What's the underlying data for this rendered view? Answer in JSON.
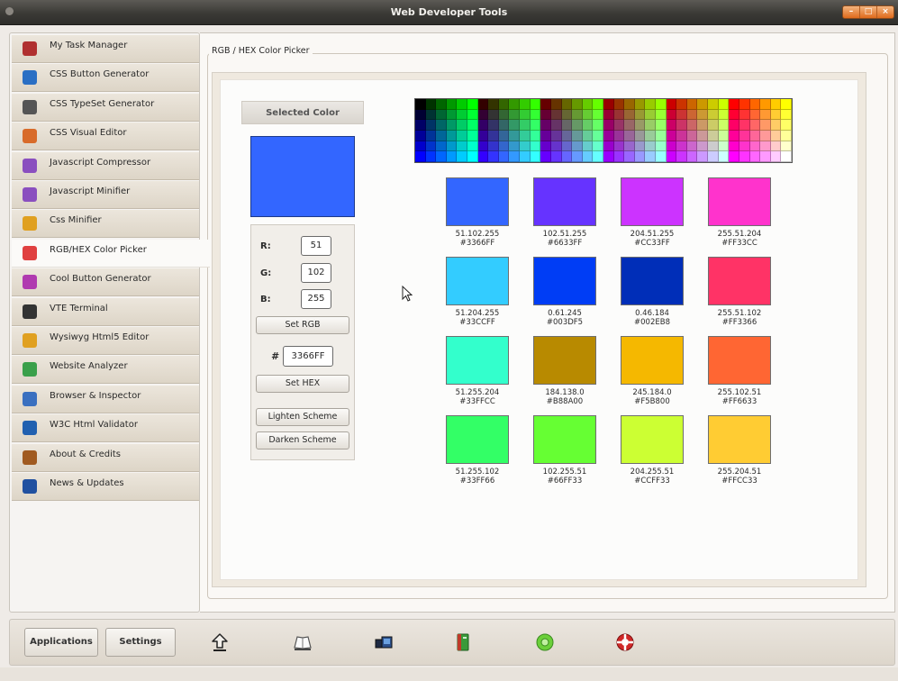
{
  "window": {
    "title": "Web Developer Tools",
    "controls": [
      "–",
      "□",
      "×"
    ]
  },
  "sidebar": {
    "items": [
      {
        "label": "My Task Manager",
        "icon": "clipboard-icon",
        "color": "#b03030"
      },
      {
        "label": "CSS Button Generator",
        "icon": "blocks-icon",
        "color": "#2a6fc4"
      },
      {
        "label": "CSS TypeSet Generator",
        "icon": "typeset-circle-icon",
        "color": "#555555"
      },
      {
        "label": "CSS Visual Editor",
        "icon": "palette-brush-icon",
        "color": "#d86b2a"
      },
      {
        "label": "Javascript Compressor",
        "icon": "js-file-icon",
        "color": "#8a4fbf"
      },
      {
        "label": "Javascript Minifier",
        "icon": "js-file-icon",
        "color": "#8a4fbf"
      },
      {
        "label": "Css Minifier",
        "icon": "css-badge-icon",
        "color": "#e0a020"
      },
      {
        "label": "RGB/HEX Color Picker",
        "icon": "color-wheel-icon",
        "color": "#e04040"
      },
      {
        "label": "Cool Button Generator",
        "icon": "button-magic-icon",
        "color": "#b03ab0"
      },
      {
        "label": "VTE Terminal",
        "icon": "terminal-icon",
        "color": "#333333"
      },
      {
        "label": "Wysiwyg Html5 Editor",
        "icon": "pencil-doc-icon",
        "color": "#e0a020"
      },
      {
        "label": "Website Analyzer",
        "icon": "gear-globe-icon",
        "color": "#3aa04a"
      },
      {
        "label": "Browser & Inspector",
        "icon": "browser-globe-icon",
        "color": "#3a70c0"
      },
      {
        "label": "W3C Html Validator",
        "icon": "w3c-icon",
        "color": "#2060b0"
      },
      {
        "label": "About & Credits",
        "icon": "person-icon",
        "color": "#a05a20"
      },
      {
        "label": "News & Updates",
        "icon": "rss-icon",
        "color": "#2050a0"
      }
    ],
    "active_index": 7
  },
  "main": {
    "group_title": "RGB / HEX Color Picker",
    "selected": {
      "header": "Selected Color",
      "color": "#3366FF",
      "r_label": "R:",
      "g_label": "G:",
      "b_label": "B:",
      "r": "51",
      "g": "102",
      "b": "255",
      "set_rgb": "Set RGB",
      "hash": "#",
      "hex": "3366FF",
      "set_hex": "Set HEX",
      "lighten": "Lighten Scheme",
      "darken": "Darken Scheme"
    },
    "swatches": [
      {
        "rgb": "51.102.255",
        "hex": "#3366FF",
        "color": "#3366FF"
      },
      {
        "rgb": "102.51.255",
        "hex": "#6633FF",
        "color": "#6633FF"
      },
      {
        "rgb": "204.51.255",
        "hex": "#CC33FF",
        "color": "#CC33FF"
      },
      {
        "rgb": "255.51.204",
        "hex": "#FF33CC",
        "color": "#FF33CC"
      },
      {
        "rgb": "51.204.255",
        "hex": "#33CCFF",
        "color": "#33CCFF"
      },
      {
        "rgb": "0.61.245",
        "hex": "#003DF5",
        "color": "#003DF5"
      },
      {
        "rgb": "0.46.184",
        "hex": "#002EB8",
        "color": "#002EB8"
      },
      {
        "rgb": "255.51.102",
        "hex": "#FF3366",
        "color": "#FF3366"
      },
      {
        "rgb": "51.255.204",
        "hex": "#33FFCC",
        "color": "#33FFCC"
      },
      {
        "rgb": "184.138.0",
        "hex": "#B88A00",
        "color": "#B88A00"
      },
      {
        "rgb": "245.184.0",
        "hex": "#F5B800",
        "color": "#F5B800"
      },
      {
        "rgb": "255.102.51",
        "hex": "#FF6633",
        "color": "#FF6633"
      },
      {
        "rgb": "51.255.102",
        "hex": "#33FF66",
        "color": "#33FF66"
      },
      {
        "rgb": "102.255.51",
        "hex": "#66FF33",
        "color": "#66FF33"
      },
      {
        "rgb": "204.255.51",
        "hex": "#CCFF33",
        "color": "#CCFF33"
      },
      {
        "rgb": "255.204.51",
        "hex": "#FFCC33",
        "color": "#FFCC33"
      }
    ]
  },
  "toolbar": {
    "applications": "Applications",
    "settings": "Settings",
    "icons": [
      "upload-arrow-icon",
      "open-book-icon",
      "monitor-icon",
      "green-book-icon",
      "green-gear-icon",
      "red-lifebuoy-icon"
    ]
  }
}
